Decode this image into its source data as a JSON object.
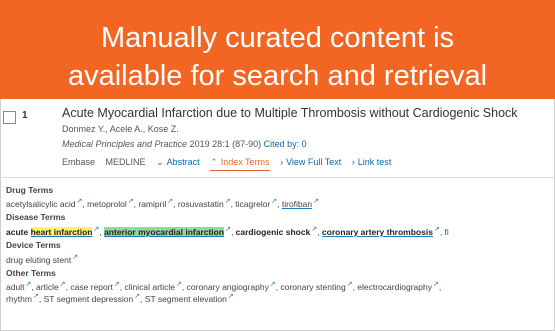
{
  "banner": {
    "line1": "Manually curated content is",
    "line2": "available for search and retrieval"
  },
  "result": {
    "number": "1",
    "title": "Acute Myocardial Infarction due to Multiple Thrombosis without Cardiogenic Shock",
    "authors": "Donmez Y., Acele A., Kose Z.",
    "journal": "Medical Principles and Practice",
    "citation": "2019 28:1 (87-90)",
    "cited_by": "Cited by: 0",
    "sources": [
      "Embase",
      "MEDLINE"
    ],
    "actions": {
      "abstract": "Abstract",
      "index_terms": "Index Terms",
      "full_text": "View Full Text",
      "link_test": "Link test"
    }
  },
  "index_terms": {
    "drug": {
      "heading": "Drug Terms",
      "terms": [
        "acetylsalicylic acid",
        "metoprolol",
        "ramipril",
        "rosuvastatin",
        "ticagrelor",
        "tirofiban"
      ]
    },
    "disease": {
      "heading": "Disease Terms",
      "prefix": "acute",
      "terms": [
        "heart infarction",
        "anterior myocardial infarction",
        "cardiogenic shock",
        "coronary artery thrombosis",
        "fi"
      ]
    },
    "device": {
      "heading": "Device Terms",
      "terms": [
        "drug eluting stent"
      ]
    },
    "other": {
      "heading": "Other Terms",
      "line1": [
        "adult",
        "article",
        "case report",
        "clinical article",
        "coronary angiography",
        "coronary stenting",
        "electrocardiography"
      ],
      "line2": [
        "rhythm",
        "ST segment depression",
        "ST segment elevation"
      ]
    }
  },
  "colors": {
    "banner": "#f26522",
    "link": "#0b6aa8",
    "active_tab": "#e06d2a",
    "highlight_yellow": "#fff36b",
    "highlight_green": "#92d9a1"
  }
}
